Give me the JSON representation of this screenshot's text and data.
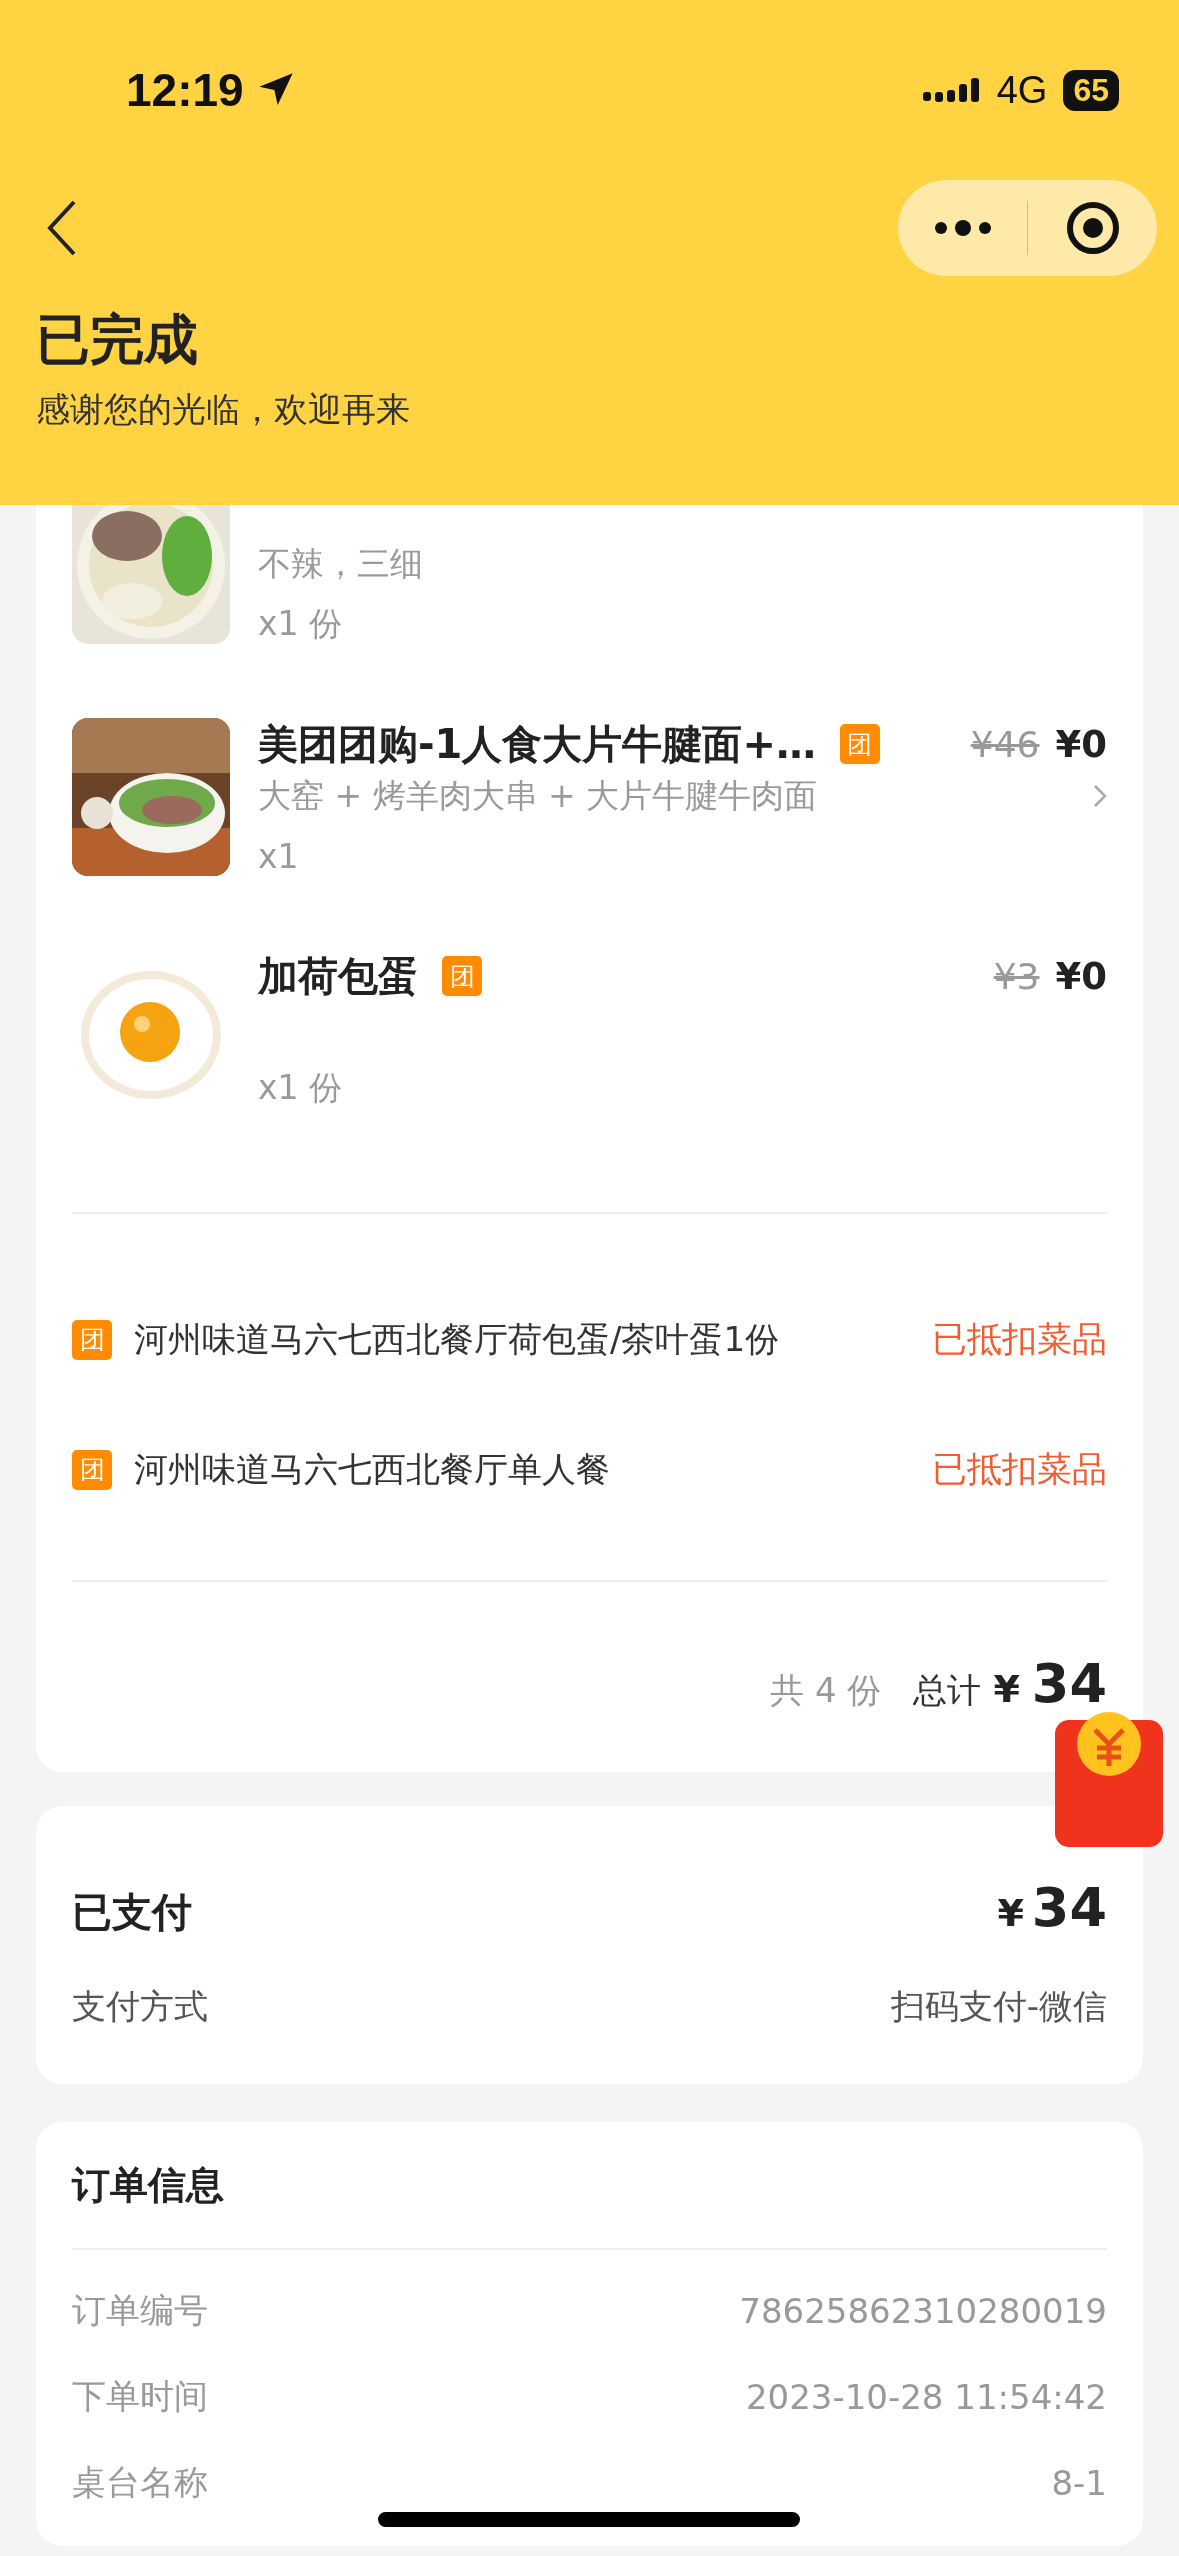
{
  "status_bar": {
    "time": "12:19",
    "network": "4G",
    "battery": "65"
  },
  "header": {
    "title": "已完成",
    "subtitle": "感谢您的光临，欢迎再来"
  },
  "items": [
    {
      "spec": "不辣，三细",
      "qty": "x1 份"
    },
    {
      "name": "美团团购-1人食大片牛腱面+…",
      "badge": "团",
      "spec": "大窑 + 烤羊肉大串 + 大片牛腱牛肉面",
      "qty": "x1",
      "original_price": "¥46",
      "price": "¥0",
      "expandable": true
    },
    {
      "name": "加荷包蛋",
      "badge": "团",
      "qty": "x1 份",
      "original_price": "¥3",
      "price": "¥0"
    }
  ],
  "vouchers": [
    {
      "badge": "团",
      "name": "河州味道马六七西北餐厅荷包蛋/茶叶蛋1份",
      "status": "已抵扣菜品"
    },
    {
      "badge": "团",
      "name": "河州味道马六七西北餐厅单人餐",
      "status": "已抵扣菜品"
    }
  ],
  "summary": {
    "count": "共 4 份",
    "total_label": "总计",
    "currency": "¥",
    "total": "34"
  },
  "payment": {
    "title": "已支付",
    "currency": "¥",
    "amount": "34",
    "method_label": "支付方式",
    "method": "扫码支付-微信"
  },
  "order_info": {
    "title": "订单信息",
    "rows": [
      {
        "label": "订单编号",
        "value": "78625862310280019"
      },
      {
        "label": "下单时间",
        "value": "2023-10-28 11:54:42"
      },
      {
        "label": "桌台名称",
        "value": "8-1"
      }
    ]
  }
}
